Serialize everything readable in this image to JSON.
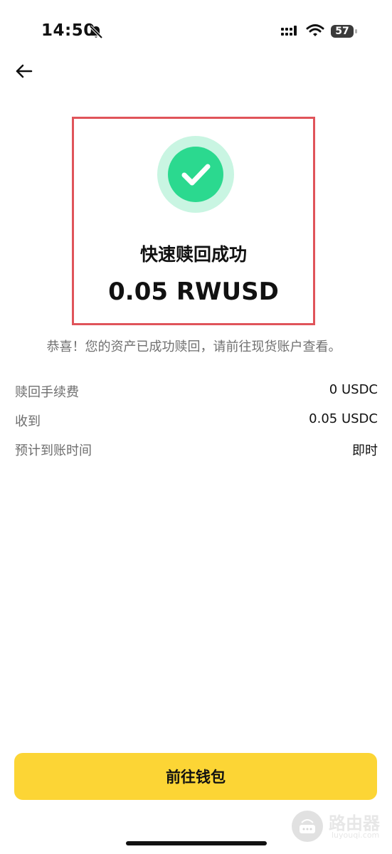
{
  "status_bar": {
    "time": "14:50",
    "battery": "57",
    "icons": [
      "bell-off-icon",
      "signal-icon",
      "wifi-icon",
      "battery-icon"
    ]
  },
  "nav": {
    "back_icon": "arrow-left-icon"
  },
  "result": {
    "icon": "check-circle-icon",
    "title": "快速赎回成功",
    "amount": "0.05 RWUSD",
    "message": "恭喜！您的资产已成功赎回，请前往现货账户查看。"
  },
  "details": [
    {
      "label": "赎回手续费",
      "value": "0 USDC"
    },
    {
      "label": "收到",
      "value": "0.05 USDC"
    },
    {
      "label": "预计到账时间",
      "value": "即时"
    }
  ],
  "action": {
    "wallet_label": "前往钱包"
  },
  "watermark": {
    "main": "路由器",
    "sub": "luyouqi.com"
  },
  "colors": {
    "accent": "#fcd535",
    "success": "#2bd98f",
    "success_ring": "#c9f5e2",
    "highlight_border": "#e0545a",
    "muted_text": "#6e6e6e"
  }
}
